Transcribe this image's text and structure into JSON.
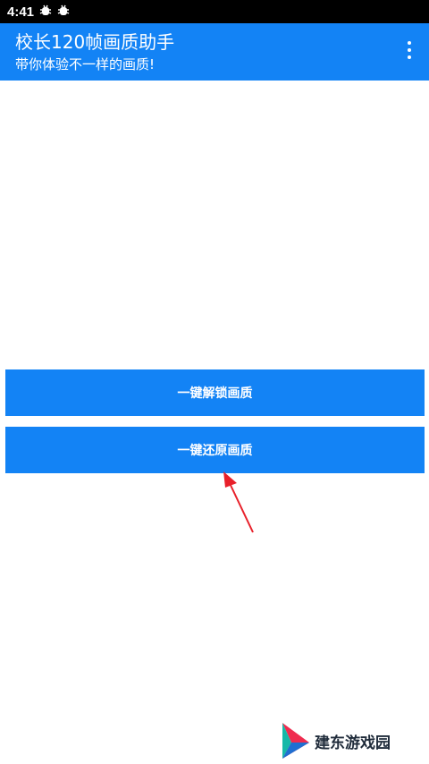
{
  "status_bar": {
    "time": "4:41",
    "notification_icons": [
      "bug-icon",
      "bug-icon"
    ]
  },
  "app_bar": {
    "title": "校长120帧画质助手",
    "subtitle": "带你体验不一样的画质!",
    "menu_icon": "more-vertical-icon",
    "background_color": "#1383f5"
  },
  "buttons": {
    "unlock_label": "一键解锁画质",
    "restore_label": "一键还原画质"
  },
  "watermark": {
    "text": "建东游戏园"
  },
  "colors": {
    "accent": "#1383f5",
    "annotation_arrow": "#e8202a"
  }
}
